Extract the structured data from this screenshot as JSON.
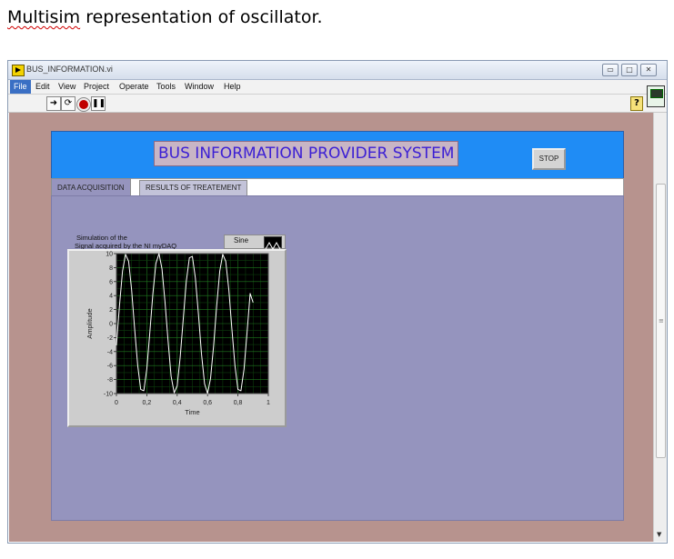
{
  "document": {
    "caption_first": "Multisim",
    "caption_rest": "representation of oscillator."
  },
  "window": {
    "title": "BUS_INFORMATION.vi",
    "controls": [
      "▭",
      "□",
      "✕"
    ]
  },
  "menubar": {
    "items": [
      "File",
      "Edit",
      "View",
      "Project",
      "Operate",
      "Tools",
      "Window",
      "Help"
    ]
  },
  "toolbar": {
    "icons": [
      "run-arrow-icon",
      "run-continuously-icon",
      "abort-icon",
      "pause-icon"
    ],
    "help": "?"
  },
  "panel": {
    "title": "BUS INFORMATION PROVIDER SYSTEM",
    "stop_label": "STOP",
    "colors": {
      "header": "#1f8cf5",
      "panel": "#9594be",
      "background": "#b7938e",
      "title_text": "#3b1fd4"
    }
  },
  "tabs": [
    {
      "label": "DATA ACQUISITION",
      "active": true
    },
    {
      "label": "RESULTS OF TREATEMENT",
      "active": false
    }
  ],
  "graph": {
    "title_line1": "Simulation of the",
    "title_line2": "Signal acquired by the NI myDAQ",
    "legend": "Sine"
  },
  "chart_data": {
    "type": "line",
    "xlabel": "Time",
    "ylabel": "Amplitude",
    "xlim": [
      0,
      1
    ],
    "ylim": [
      -10,
      10
    ],
    "x_ticks": [
      "0",
      "0,2",
      "0,4",
      "0,6",
      "0,8",
      "1"
    ],
    "y_ticks": [
      "10",
      "8",
      "6",
      "4",
      "2",
      "0",
      "-2",
      "-4",
      "-6",
      "-8",
      "-10"
    ],
    "grid": true,
    "legend_position": "top-right",
    "series": [
      {
        "name": "Sine",
        "color": "#ffffff",
        "x": [
          0,
          0.02,
          0.04,
          0.06,
          0.08,
          0.1,
          0.12,
          0.14,
          0.16,
          0.18,
          0.2,
          0.22,
          0.24,
          0.26,
          0.28,
          0.3,
          0.32,
          0.34,
          0.36,
          0.38,
          0.4,
          0.42,
          0.44,
          0.46,
          0.48,
          0.5,
          0.52,
          0.54,
          0.56,
          0.58,
          0.6,
          0.62,
          0.64,
          0.66,
          0.68,
          0.7,
          0.72,
          0.74,
          0.76,
          0.78,
          0.8,
          0.82,
          0.84,
          0.86,
          0.88,
          0.9
        ],
        "y": [
          -3.1,
          2.5,
          7.5,
          9.9,
          8.9,
          4.8,
          -0.7,
          -6.0,
          -9.4,
          -9.6,
          -6.5,
          -1.3,
          4.3,
          8.6,
          10.0,
          7.8,
          3.1,
          -2.5,
          -7.5,
          -9.9,
          -8.9,
          -4.8,
          0.7,
          6.0,
          9.4,
          9.6,
          6.5,
          1.3,
          -4.3,
          -8.6,
          -10.0,
          -7.8,
          -3.1,
          2.5,
          7.5,
          9.9,
          8.9,
          4.8,
          -0.7,
          -6.0,
          -9.4,
          -9.6,
          -6.5,
          -1.3,
          4.3,
          3.0
        ]
      }
    ]
  }
}
